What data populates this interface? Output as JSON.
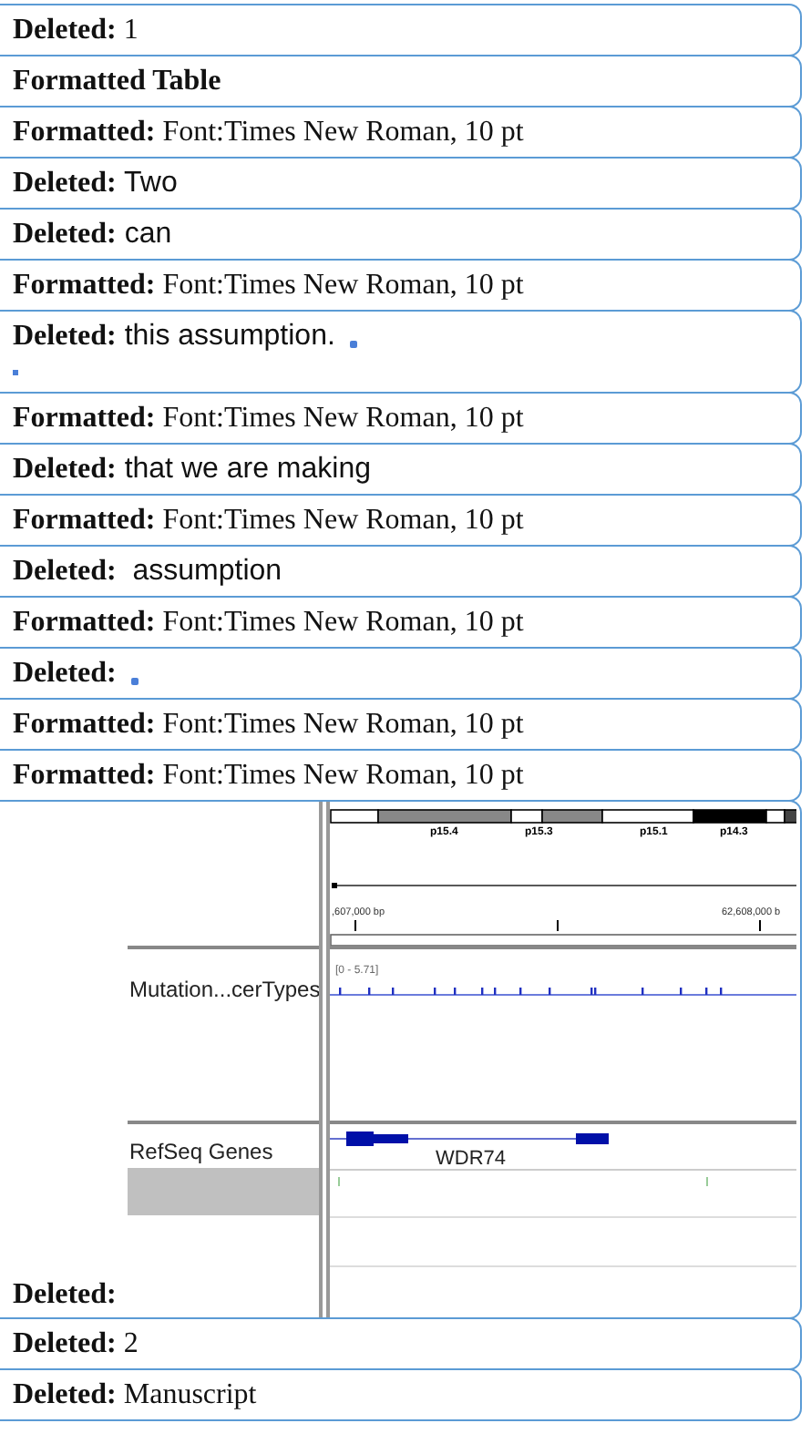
{
  "balloons": [
    {
      "kind": "serif",
      "label": "Deleted:",
      "text": "1"
    },
    {
      "kind": "title",
      "label": "Formatted Table"
    },
    {
      "kind": "serif",
      "label": "Formatted:",
      "text": "Font:Times New Roman, 10 pt"
    },
    {
      "kind": "sans",
      "label": "Deleted:",
      "text": "Two"
    },
    {
      "kind": "sans",
      "label": "Deleted:",
      "text": "can"
    },
    {
      "kind": "serif",
      "label": "Formatted:",
      "text": "Font:Times New Roman, 10 pt"
    },
    {
      "kind": "sans",
      "label": "Deleted:",
      "text": "this assumption.",
      "paragraph_mark": true,
      "empty_line_mark": true
    },
    {
      "kind": "serif",
      "label": "Formatted:",
      "text": "Font:Times New Roman, 10 pt"
    },
    {
      "kind": "sans",
      "label": "Deleted:",
      "text": "that we are making"
    },
    {
      "kind": "serif",
      "label": "Formatted:",
      "text": "Font:Times New Roman, 10 pt"
    },
    {
      "kind": "sans",
      "label": "Deleted:",
      "text": " assumption"
    },
    {
      "kind": "serif",
      "label": "Formatted:",
      "text": "Font:Times New Roman, 10 pt"
    },
    {
      "kind": "title",
      "label": "Deleted:",
      "paragraph_mark": true
    },
    {
      "kind": "serif",
      "label": "Formatted:",
      "text": "Font:Times New Roman, 10 pt"
    },
    {
      "kind": "serif",
      "label": "Formatted:",
      "text": "Font:Times New Roman, 10 pt"
    },
    {
      "kind": "figure",
      "label": "Deleted:",
      "figure": {
        "bands": [
          "p15.4",
          "p15.3",
          "p15.1",
          "p14.3"
        ],
        "ruler": [
          ",607,000 bp",
          "62,608,000 b"
        ],
        "tracks": [
          {
            "name": "Mutation...cerTypes",
            "range": "[0 - 5.71]"
          },
          {
            "name": "RefSeq Genes",
            "gene": "WDR74"
          }
        ]
      }
    },
    {
      "kind": "serif",
      "label": "Deleted:",
      "text": "2"
    },
    {
      "kind": "serif",
      "label": "Deleted:",
      "text": "Manuscript"
    }
  ]
}
